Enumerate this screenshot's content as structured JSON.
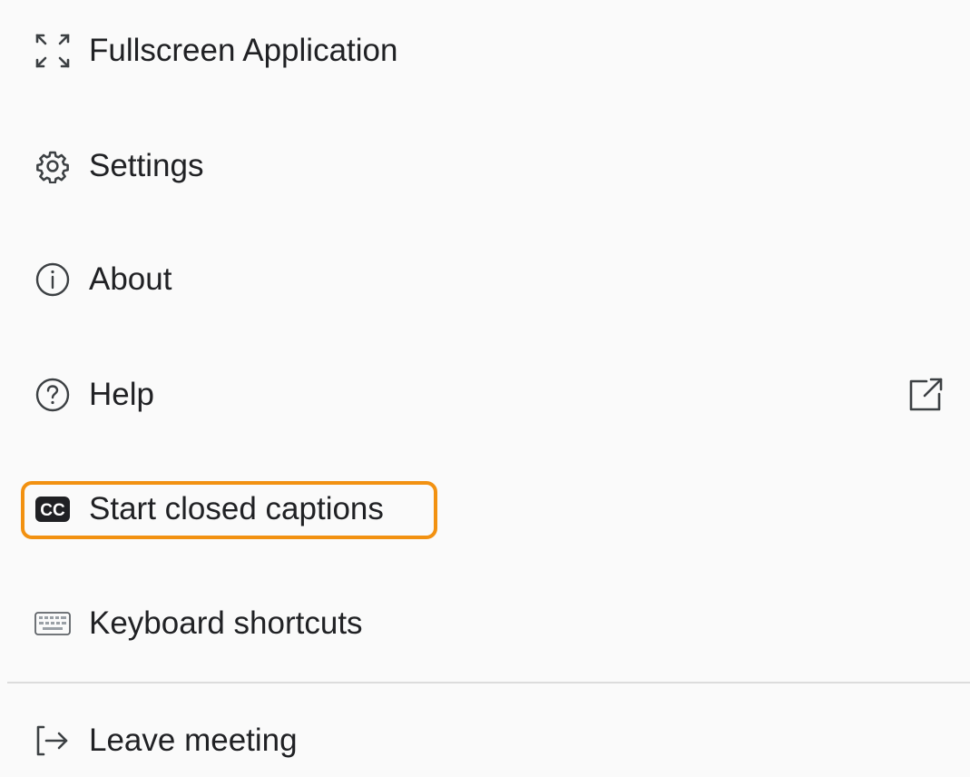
{
  "menu": {
    "items": [
      {
        "label": "Fullscreen Application",
        "icon": "fullscreen-icon"
      },
      {
        "label": "Settings",
        "icon": "gear-icon"
      },
      {
        "label": "About",
        "icon": "info-icon"
      },
      {
        "label": "Help",
        "icon": "help-icon",
        "trailing_icon": "external-link-icon"
      },
      {
        "label": "Start closed captions",
        "icon": "closed-captions-icon",
        "highlighted": true
      },
      {
        "label": "Keyboard shortcuts",
        "icon": "keyboard-icon"
      },
      {
        "label": "Leave meeting",
        "icon": "leave-icon"
      }
    ]
  },
  "colors": {
    "highlight": "#f29111",
    "text": "#202124",
    "background": "#fafafa",
    "divider": "#dcdcdc"
  }
}
